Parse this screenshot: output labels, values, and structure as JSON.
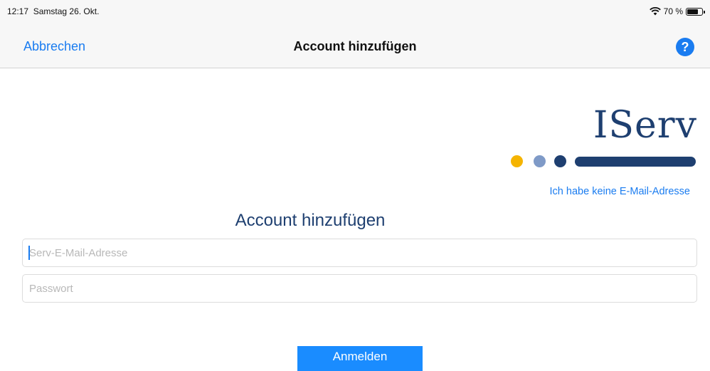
{
  "status_bar": {
    "time": "12:17",
    "date": "Samstag 26. Okt.",
    "battery": "70 %",
    "icons": [
      "wifi-icon",
      "battery-icon"
    ]
  },
  "nav_bar": {
    "cancel_label": "Abbrechen",
    "title": "Account hinzufügen",
    "help_label": "?"
  },
  "logo": {
    "text": "IServ",
    "colors": {
      "brand_dark": "#1e3f70",
      "dot_yellow": "#f5b400",
      "dot_light": "#7f9ac7"
    }
  },
  "no_email_link": "Ich habe keine E-Mail-Adresse",
  "form": {
    "heading": "Account hinzufügen",
    "email_placeholder": "Serv-E-Mail-Adresse",
    "email_value": "",
    "password_placeholder": "Passwort",
    "password_value": "",
    "submit_label": "Anmelden"
  },
  "colors": {
    "accent": "#1a7cf0",
    "button": "#1a8cff"
  }
}
